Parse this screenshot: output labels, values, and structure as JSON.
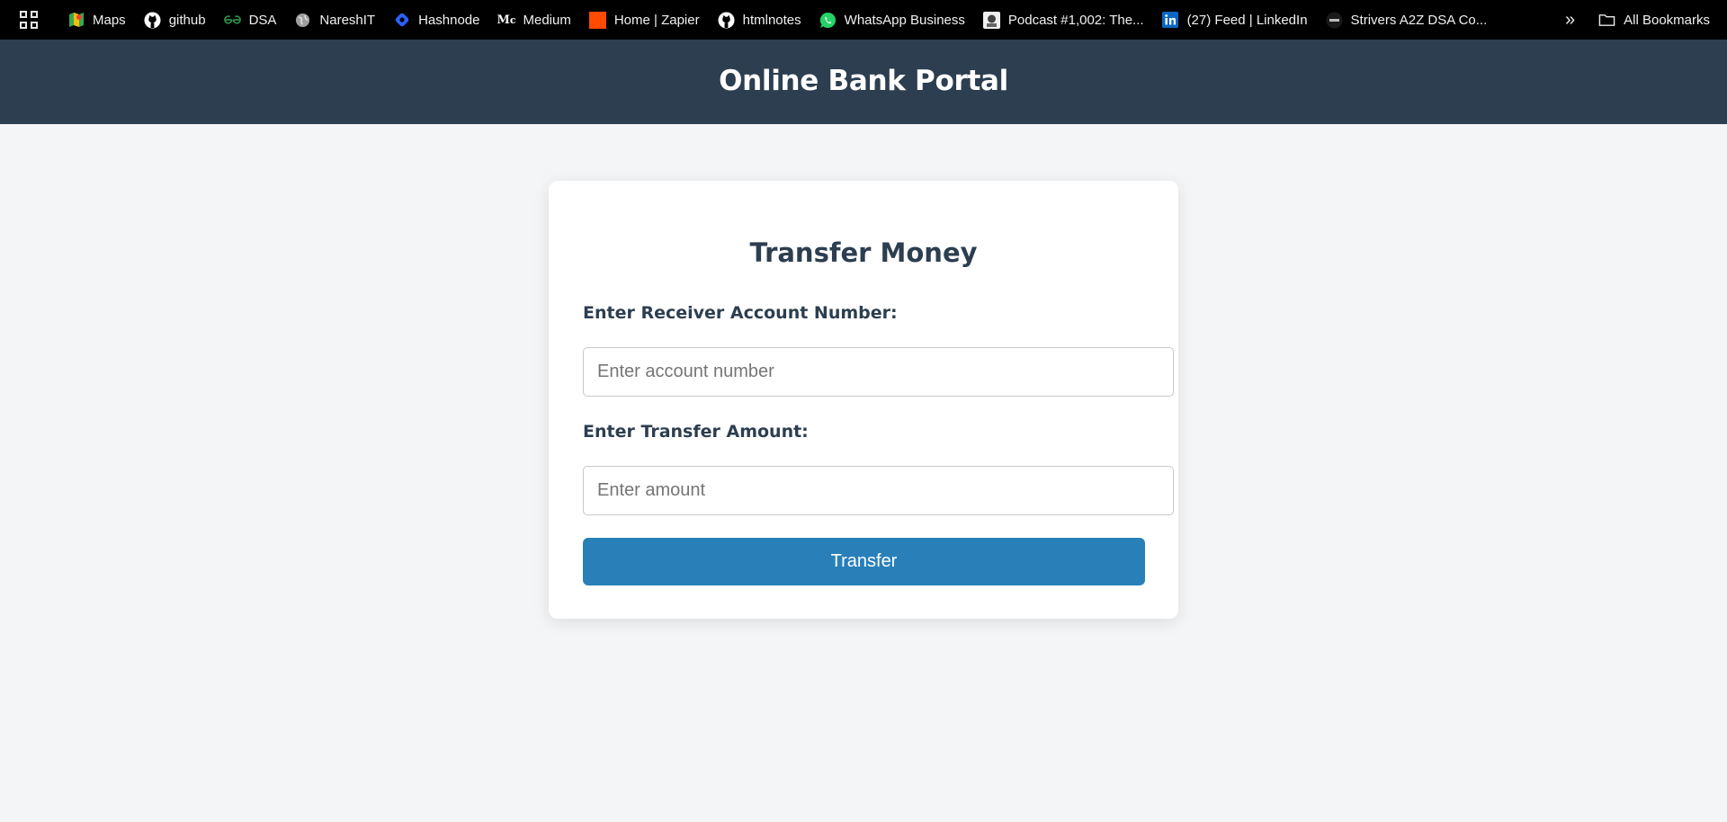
{
  "bookmarks": [
    {
      "label": "Maps",
      "icon": "maps-icon"
    },
    {
      "label": "github",
      "icon": "github-icon"
    },
    {
      "label": "DSA",
      "icon": "geeksforgeeks-icon"
    },
    {
      "label": "NareshIT",
      "icon": "globe-icon"
    },
    {
      "label": "Hashnode",
      "icon": "hashnode-icon"
    },
    {
      "label": "Medium",
      "icon": "medium-icon"
    },
    {
      "label": "Home | Zapier",
      "icon": "zapier-icon"
    },
    {
      "label": "htmlnotes",
      "icon": "github-icon"
    },
    {
      "label": "WhatsApp Business",
      "icon": "whatsapp-icon"
    },
    {
      "label": "Podcast #1,002: The...",
      "icon": "podcast-icon"
    },
    {
      "label": "(27) Feed | LinkedIn",
      "icon": "linkedin-icon"
    },
    {
      "label": "Strivers A2Z DSA Co...",
      "icon": "tuf-icon"
    }
  ],
  "bookmarks_overflow_label": "»",
  "all_bookmarks_label": "All Bookmarks",
  "header": {
    "title": "Online Bank Portal"
  },
  "form": {
    "title": "Transfer Money",
    "account_label": "Enter Receiver Account Number:",
    "account_placeholder": "Enter account number",
    "amount_label": "Enter Transfer Amount:",
    "amount_placeholder": "Enter amount",
    "submit_label": "Transfer"
  },
  "colors": {
    "header_bg": "#2c3e50",
    "button_bg": "#2980b9",
    "page_bg": "#f4f5f7",
    "bookmarks_bg": "#000000"
  }
}
